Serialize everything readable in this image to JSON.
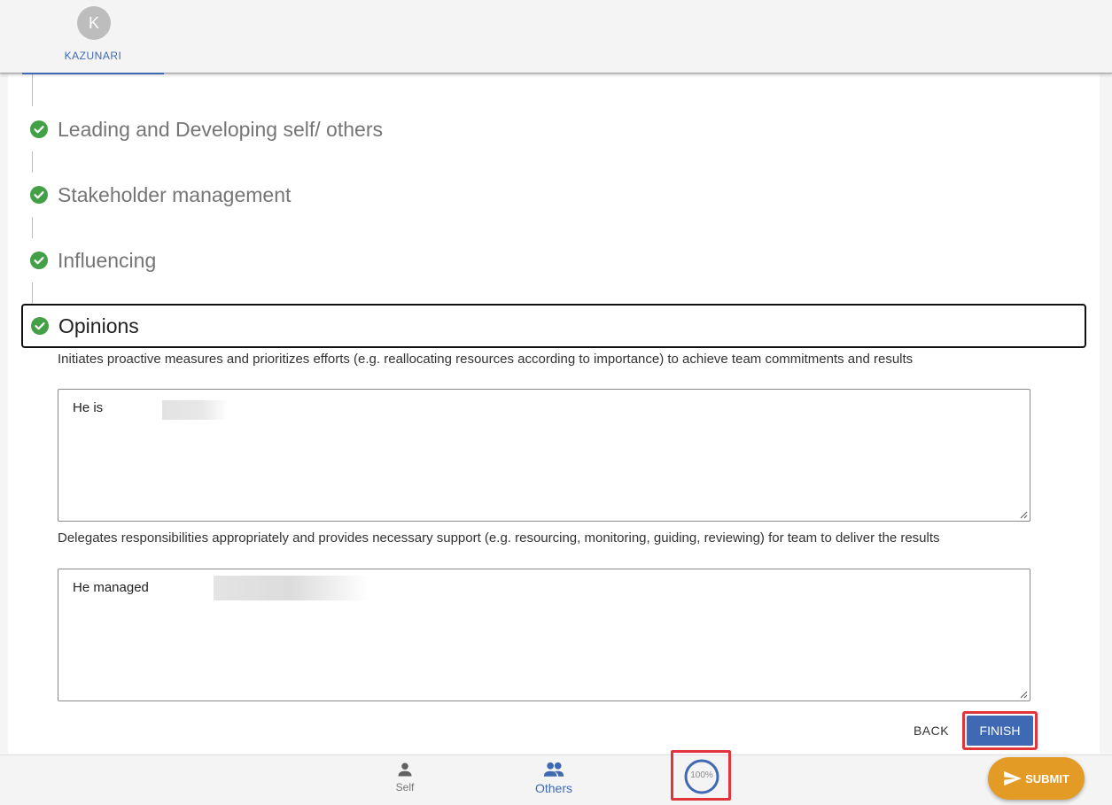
{
  "header": {
    "tab": {
      "avatar_initial": "K",
      "label": "KAZUNARI"
    }
  },
  "steps": [
    {
      "title": "Leading and Developing self/ others",
      "status": "complete"
    },
    {
      "title": "Stakeholder management",
      "status": "complete"
    },
    {
      "title": "Influencing",
      "status": "complete"
    },
    {
      "title": "Opinions",
      "status": "complete",
      "active": true
    }
  ],
  "questions": [
    {
      "text": "Initiates proactive measures and prioritizes efforts (e.g. reallocating resources according to importance) to achieve team commitments and results",
      "answer": "He is"
    },
    {
      "text": "Delegates responsibilities appropriately and provides necessary support (e.g. resourcing, monitoring, guiding, reviewing) for team to deliver the results",
      "answer": "He managed"
    }
  ],
  "actions": {
    "back_label": "BACK",
    "finish_label": "FINISH"
  },
  "bottom_nav": {
    "items": [
      {
        "label": "Self",
        "icon": "person-icon",
        "active": false
      },
      {
        "label": "Others",
        "icon": "people-icon",
        "active": true
      }
    ],
    "progress": {
      "value": 100,
      "text": "100%"
    },
    "submit_label": "SUBMIT"
  },
  "colors": {
    "accent": "#3f6ab3",
    "success": "#43a047",
    "submit": "#e39b25",
    "highlight": "#e0363b"
  }
}
